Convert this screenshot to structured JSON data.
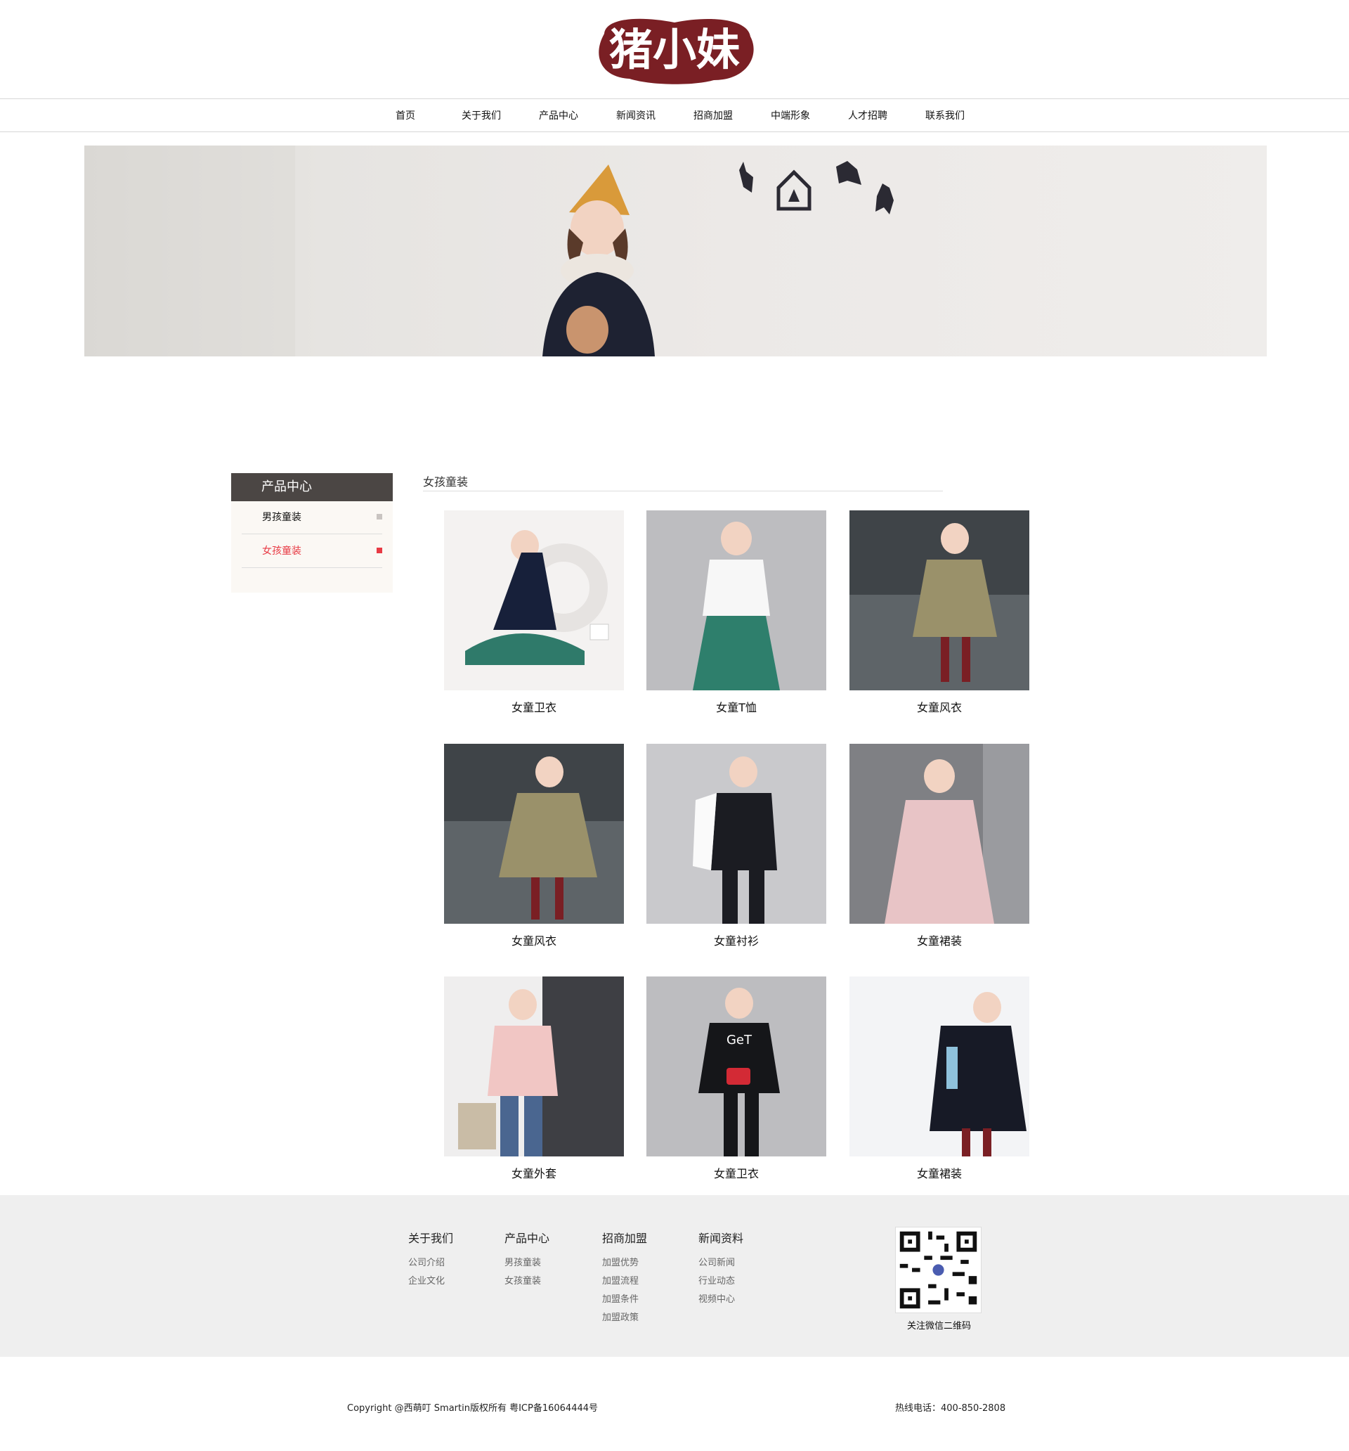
{
  "header": {
    "logo_text": "猪小妹",
    "brand_color": "#7a1f24"
  },
  "nav": {
    "items": [
      {
        "label": "首页"
      },
      {
        "label": "关于我们"
      },
      {
        "label": "产品中心"
      },
      {
        "label": "新闻资讯"
      },
      {
        "label": "招商加盟"
      },
      {
        "label": "中端形象"
      },
      {
        "label": "人才招聘"
      },
      {
        "label": "联系我们"
      }
    ]
  },
  "sidebar": {
    "title": "产品中心",
    "items": [
      {
        "label": "男孩童装",
        "active": false
      },
      {
        "label": "女孩童装",
        "active": true
      }
    ],
    "active_color": "#e83a44"
  },
  "content": {
    "title": "女孩童装",
    "products": [
      {
        "label": "女童卫衣"
      },
      {
        "label": "女童T恤"
      },
      {
        "label": "女童风衣"
      },
      {
        "label": "女童风衣"
      },
      {
        "label": "女童衬衫"
      },
      {
        "label": "女童裙装"
      },
      {
        "label": "女童外套"
      },
      {
        "label": "女童卫衣"
      },
      {
        "label": "女童裙装"
      }
    ]
  },
  "footer": {
    "columns": [
      {
        "heading": "关于我们",
        "links": [
          "公司介绍",
          "企业文化"
        ]
      },
      {
        "heading": "产品中心",
        "links": [
          "男孩童装",
          "女孩童装"
        ]
      },
      {
        "heading": "招商加盟",
        "links": [
          "加盟优势",
          "加盟流程",
          "加盟条件",
          "加盟政策"
        ]
      },
      {
        "heading": "新闻资料",
        "links": [
          "公司新闻",
          "行业动态",
          "视频中心"
        ]
      }
    ],
    "qr_caption": "关注微信二维码",
    "copyright": "Copyright @西萌叮 Smartin版权所有  粤ICP备16064444号",
    "hotline": "热线电话：400-850-2808"
  }
}
